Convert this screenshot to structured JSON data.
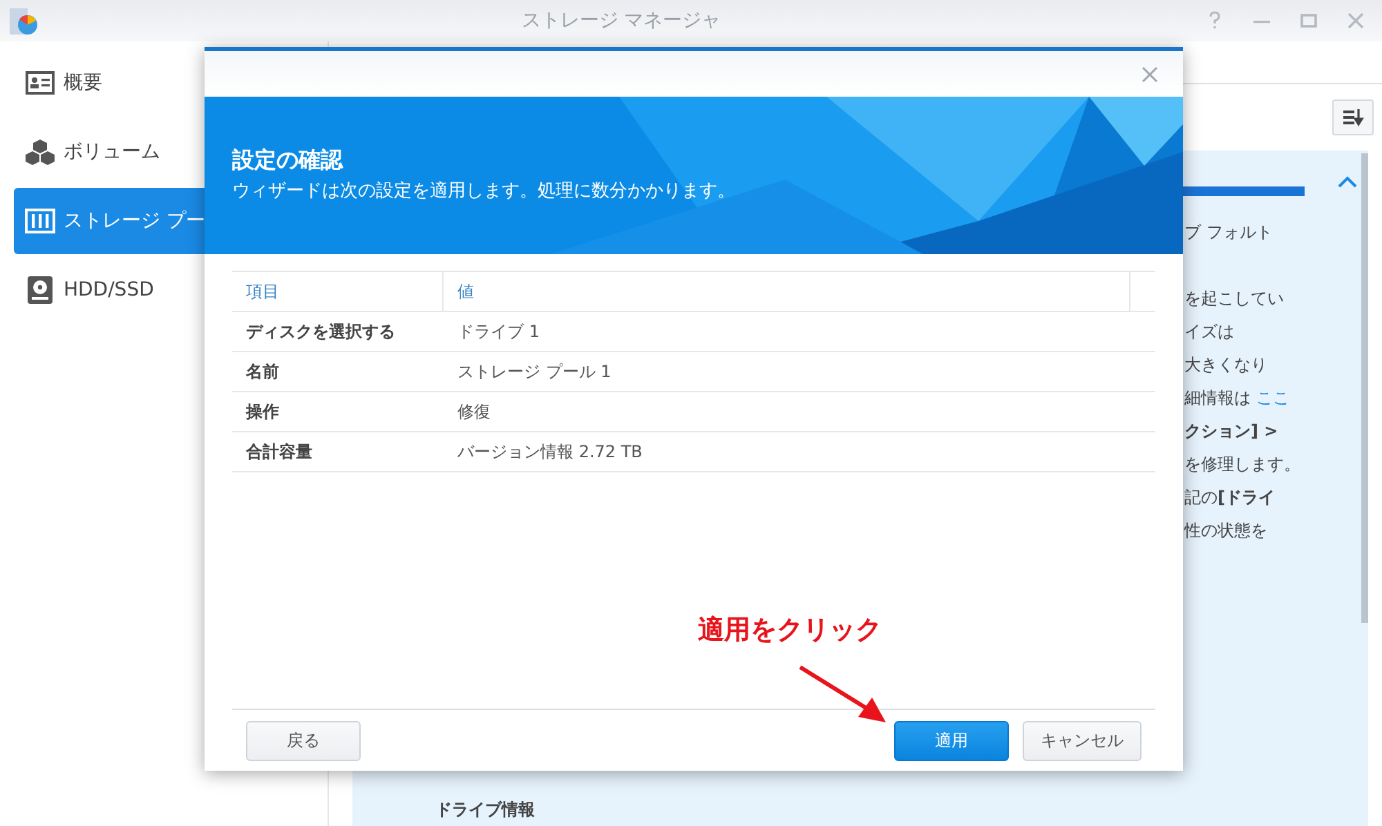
{
  "window": {
    "title": "ストレージ マネージャ"
  },
  "sidebar": {
    "items": [
      {
        "label": "概要",
        "kind": "overview",
        "selected": false
      },
      {
        "label": "ボリューム",
        "kind": "volume",
        "selected": false
      },
      {
        "label": "ストレージ プー",
        "kind": "pool",
        "selected": true
      },
      {
        "label": "HDD/SSD",
        "kind": "disk",
        "selected": false
      }
    ]
  },
  "detail_panel": {
    "lines": [
      {
        "text": "ブ フォルト"
      },
      {
        "text": "を起こしてい"
      },
      {
        "text": "イズは"
      },
      {
        "text": "大きくなり"
      },
      {
        "text": "細情報は",
        "link": "ここ"
      },
      {
        "text": "クション] >",
        "bold": true
      },
      {
        "text": "を修理します。"
      },
      {
        "text": "記の**[ドライ**"
      },
      {
        "text": "性の状態を"
      }
    ],
    "rows": [
      {
        "label": "ドライブ情報"
      }
    ]
  },
  "dialog": {
    "title": "設定の確認",
    "subtitle": "ウィザードは次の設定を適用します。処理に数分かかります。",
    "table": {
      "columns": [
        "項目",
        "値"
      ],
      "rows": [
        [
          "ディスクを選択する",
          "ドライブ 1"
        ],
        [
          "名前",
          "ストレージ プール 1"
        ],
        [
          "操作",
          "修復"
        ],
        [
          "合計容量",
          "バージョン情報 2.72 TB"
        ]
      ]
    },
    "buttons": [
      {
        "label": "戻る",
        "primary": false
      },
      {
        "label": "適用",
        "primary": true
      },
      {
        "label": "キャンセル",
        "primary": false
      }
    ]
  },
  "annotation": {
    "text": "適用をクリック"
  }
}
